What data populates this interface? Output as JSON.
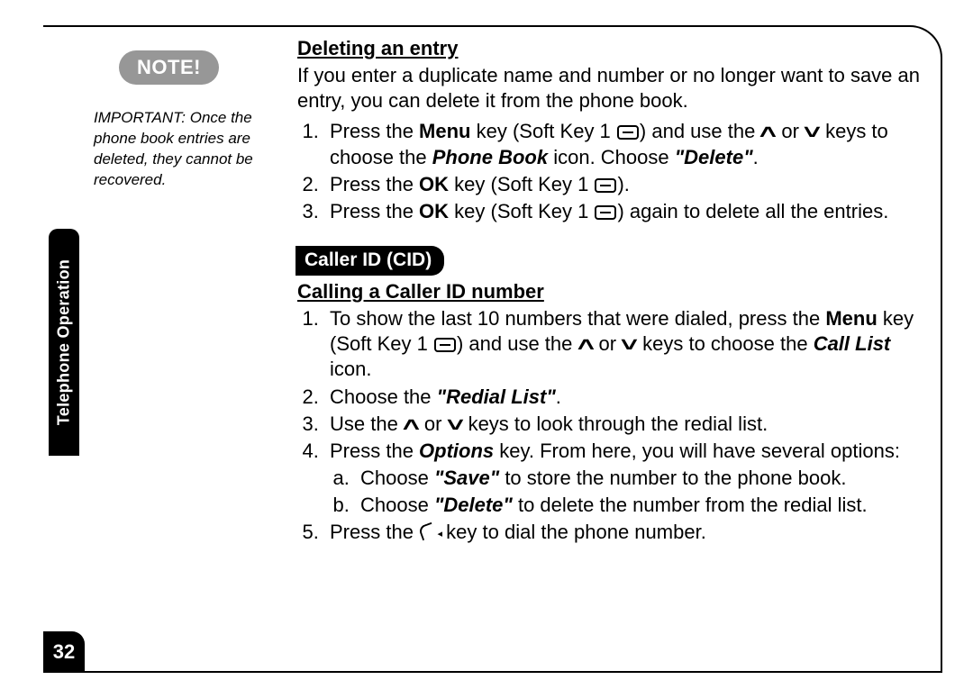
{
  "sidebar": {
    "note_label": "NOTE!",
    "note_text": "IMPORTANT: Once the phone book entries are deleted, they cannot be recovered.",
    "tab_label": "Telephone Operation",
    "page_number": "32"
  },
  "sections": {
    "deleting": {
      "heading": "Deleting an entry",
      "intro": "If you enter a duplicate name and number or no longer want to save an entry, you can delete it from the phone book.",
      "step1_a": "Press the ",
      "step1_menu": "Menu",
      "step1_b": " key (Soft Key 1 ",
      "step1_c": ") and use the ",
      "step1_or": " or ",
      "step1_d": " keys to choose the ",
      "step1_phonebook": "Phone Book",
      "step1_e": " icon. Choose ",
      "step1_delete": "\"Delete\"",
      "step1_f": ".",
      "step2_a": "Press the ",
      "step2_ok": "OK",
      "step2_b": " key (Soft Key 1 ",
      "step2_c": ").",
      "step3_a": "Press the ",
      "step3_ok": "OK",
      "step3_b": " key (Soft Key 1 ",
      "step3_c": ") again to delete all the entries."
    },
    "cid_badge": "Caller ID (CID)",
    "calling": {
      "heading": "Calling a Caller ID number",
      "step1_a": "To show the last 10 numbers that were dialed, press the ",
      "step1_menu": "Menu",
      "step1_b": " key (Soft Key 1 ",
      "step1_c": ") and use the ",
      "step1_or": " or ",
      "step1_d": " keys to choose the ",
      "step1_calllist": "Call List",
      "step1_e": " icon.",
      "step2_a": "Choose the ",
      "step2_redial": "\"Redial List\"",
      "step2_b": ".",
      "step3_a": "Use the ",
      "step3_or": " or ",
      "step3_b": " keys to look through the redial list.",
      "step4_a": "Press the ",
      "step4_options": "Options",
      "step4_b": " key. From here, you will have several options:",
      "step4a_a": "Choose ",
      "step4a_save": "\"Save\"",
      "step4a_b": " to store the number to the phone book.",
      "step4b_a": "Choose ",
      "step4b_delete": "\"Delete\"",
      "step4b_b": " to delete the number from the redial list.",
      "step5_a": "Press the ",
      "step5_b": " key to dial the phone number."
    }
  }
}
